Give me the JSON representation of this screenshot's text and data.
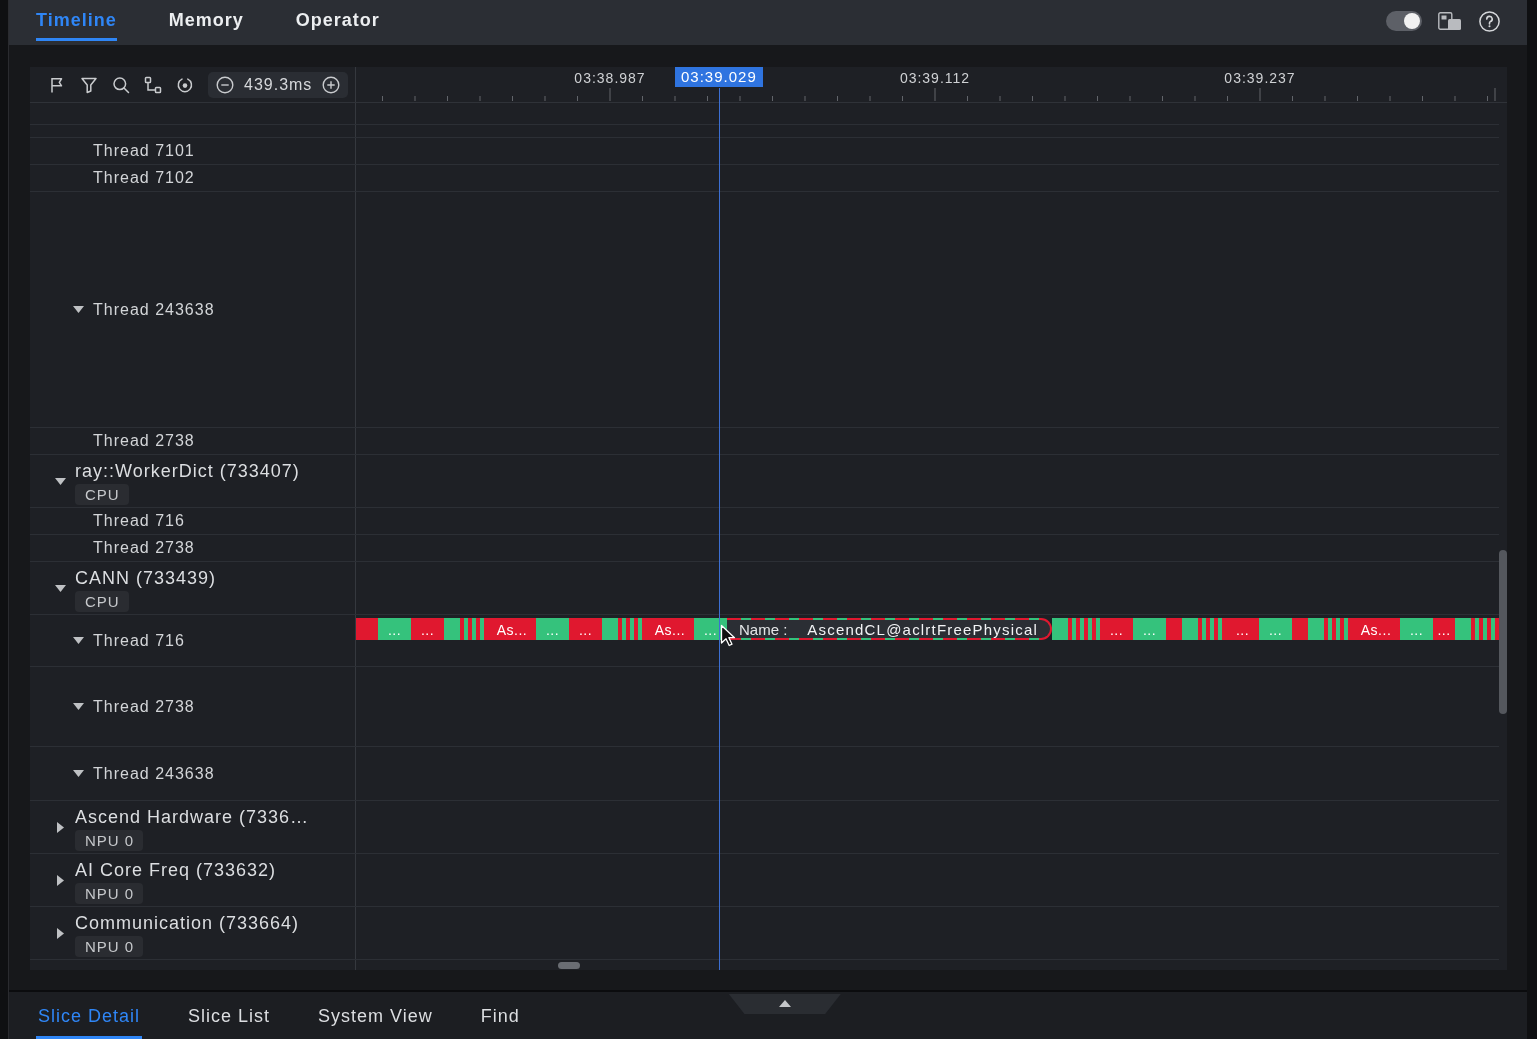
{
  "top_bar": {
    "tabs": [
      {
        "label": "Timeline",
        "selected": true
      },
      {
        "label": "Memory",
        "selected": false
      },
      {
        "label": "Operator",
        "selected": false
      }
    ],
    "toggle": {
      "on": true
    }
  },
  "timeline": {
    "zoom": "439.3ms",
    "ruler": {
      "labels": [
        "03:38.987",
        "03:39.112",
        "03:39.237"
      ],
      "cursor_time": "03:39.029"
    },
    "tracks": [
      {
        "children": [
          {
            "label": "Thread 7101"
          },
          {
            "label": "Thread 7102"
          },
          {
            "label": "Thread 243638",
            "expanded": true
          },
          {
            "label": "Thread 2738"
          }
        ]
      },
      {
        "label": "ray::WorkerDict (733407)",
        "badge": "CPU",
        "expanded": true,
        "children": [
          {
            "label": "Thread 716"
          },
          {
            "label": "Thread 2738"
          }
        ]
      },
      {
        "label": "CANN (733439)",
        "badge": "CPU",
        "expanded": true,
        "children": [
          {
            "label": "Thread 716",
            "expanded": true,
            "slices_before_tooltip": [
              {
                "kind": "medium",
                "color": "#e0182f"
              },
              {
                "kind": "block",
                "color": "#35c27c",
                "label": "..."
              },
              {
                "kind": "block",
                "color": "#e0182f",
                "label": "..."
              },
              {
                "kind": "short",
                "color": "#35c27c"
              },
              {
                "kind": "stripe",
                "color": "#e0182f"
              },
              {
                "kind": "stripe",
                "color": "#35c27c"
              },
              {
                "kind": "stripe",
                "color": "#e0182f"
              },
              {
                "kind": "stripe",
                "color": "#35c27c"
              },
              {
                "kind": "stripe",
                "color": "#e0182f"
              },
              {
                "kind": "stripe",
                "color": "#35c27c"
              },
              {
                "kind": "stripe",
                "color": "#e0182f"
              },
              {
                "kind": "long",
                "color": "#e0182f",
                "label": "As..."
              },
              {
                "kind": "block",
                "color": "#35c27c",
                "label": "..."
              },
              {
                "kind": "block",
                "color": "#e0182f",
                "label": "..."
              },
              {
                "kind": "short",
                "color": "#35c27c"
              },
              {
                "kind": "stripe",
                "color": "#e0182f"
              },
              {
                "kind": "stripe",
                "color": "#35c27c"
              },
              {
                "kind": "stripe",
                "color": "#e0182f"
              },
              {
                "kind": "stripe",
                "color": "#35c27c"
              },
              {
                "kind": "stripe",
                "color": "#e0182f"
              },
              {
                "kind": "stripe",
                "color": "#35c27c"
              },
              {
                "kind": "stripe",
                "color": "#e0182f"
              },
              {
                "kind": "long",
                "color": "#e0182f",
                "label": "As..."
              },
              {
                "kind": "block",
                "color": "#35c27c",
                "label": "..."
              }
            ],
            "tooltip": {
              "label": "Name :",
              "value": "AscendCL@aclrtFreePhysical"
            },
            "slices_after_tooltip": [
              {
                "kind": "short",
                "color": "#35c27c"
              },
              {
                "kind": "stripe",
                "color": "#e0182f"
              },
              {
                "kind": "stripe",
                "color": "#35c27c"
              },
              {
                "kind": "stripe",
                "color": "#e0182f"
              },
              {
                "kind": "stripe",
                "color": "#35c27c"
              },
              {
                "kind": "stripe",
                "color": "#e0182f"
              },
              {
                "kind": "stripe",
                "color": "#35c27c"
              },
              {
                "kind": "stripe",
                "color": "#e0182f"
              },
              {
                "kind": "stripe",
                "color": "#35c27c"
              },
              {
                "kind": "block",
                "color": "#e0182f",
                "label": "..."
              },
              {
                "kind": "block",
                "color": "#35c27c",
                "label": "..."
              },
              {
                "kind": "short",
                "color": "#e0182f"
              },
              {
                "kind": "short",
                "color": "#35c27c"
              },
              {
                "kind": "stripe",
                "color": "#e0182f"
              },
              {
                "kind": "stripe",
                "color": "#35c27c"
              },
              {
                "kind": "stripe",
                "color": "#e0182f"
              },
              {
                "kind": "stripe",
                "color": "#35c27c"
              },
              {
                "kind": "stripe",
                "color": "#e0182f"
              },
              {
                "kind": "stripe",
                "color": "#35c27c"
              },
              {
                "kind": "stripe",
                "color": "#e0182f"
              },
              {
                "kind": "block",
                "color": "#e0182f",
                "label": "..."
              },
              {
                "kind": "block",
                "color": "#35c27c",
                "label": "..."
              },
              {
                "kind": "short",
                "color": "#e0182f"
              },
              {
                "kind": "short",
                "color": "#35c27c"
              },
              {
                "kind": "stripe",
                "color": "#e0182f"
              },
              {
                "kind": "stripe",
                "color": "#35c27c"
              },
              {
                "kind": "stripe",
                "color": "#e0182f"
              },
              {
                "kind": "stripe",
                "color": "#35c27c"
              },
              {
                "kind": "stripe",
                "color": "#e0182f"
              },
              {
                "kind": "stripe",
                "color": "#35c27c"
              },
              {
                "kind": "stripe",
                "color": "#e0182f"
              },
              {
                "kind": "long",
                "color": "#e0182f",
                "label": "As..."
              },
              {
                "kind": "block",
                "color": "#35c27c",
                "label": "..."
              },
              {
                "kind": "medium",
                "color": "#e0182f",
                "label": "..."
              },
              {
                "kind": "short",
                "color": "#35c27c"
              },
              {
                "kind": "stripe",
                "color": "#e0182f"
              },
              {
                "kind": "stripe",
                "color": "#35c27c"
              },
              {
                "kind": "stripe",
                "color": "#e0182f"
              },
              {
                "kind": "stripe",
                "color": "#35c27c"
              },
              {
                "kind": "stripe",
                "color": "#e0182f"
              },
              {
                "kind": "stripe",
                "color": "#35c27c"
              },
              {
                "kind": "stripe",
                "color": "#e0182f"
              }
            ]
          },
          {
            "label": "Thread 2738",
            "expanded": true
          },
          {
            "label": "Thread 243638",
            "expanded": true
          }
        ]
      },
      {
        "label": "Ascend Hardware (7336…",
        "badge": "NPU 0",
        "expanded": false
      },
      {
        "label": "AI Core Freq (733632)",
        "badge": "NPU 0",
        "expanded": false
      },
      {
        "label": "Communication (733664)",
        "badge": "NPU 0",
        "expanded": false
      }
    ]
  },
  "bottom_panel": {
    "tabs": [
      {
        "label": "Slice Detail",
        "selected": true
      },
      {
        "label": "Slice List",
        "selected": false
      },
      {
        "label": "System View",
        "selected": false
      },
      {
        "label": "Find",
        "selected": false
      }
    ]
  }
}
